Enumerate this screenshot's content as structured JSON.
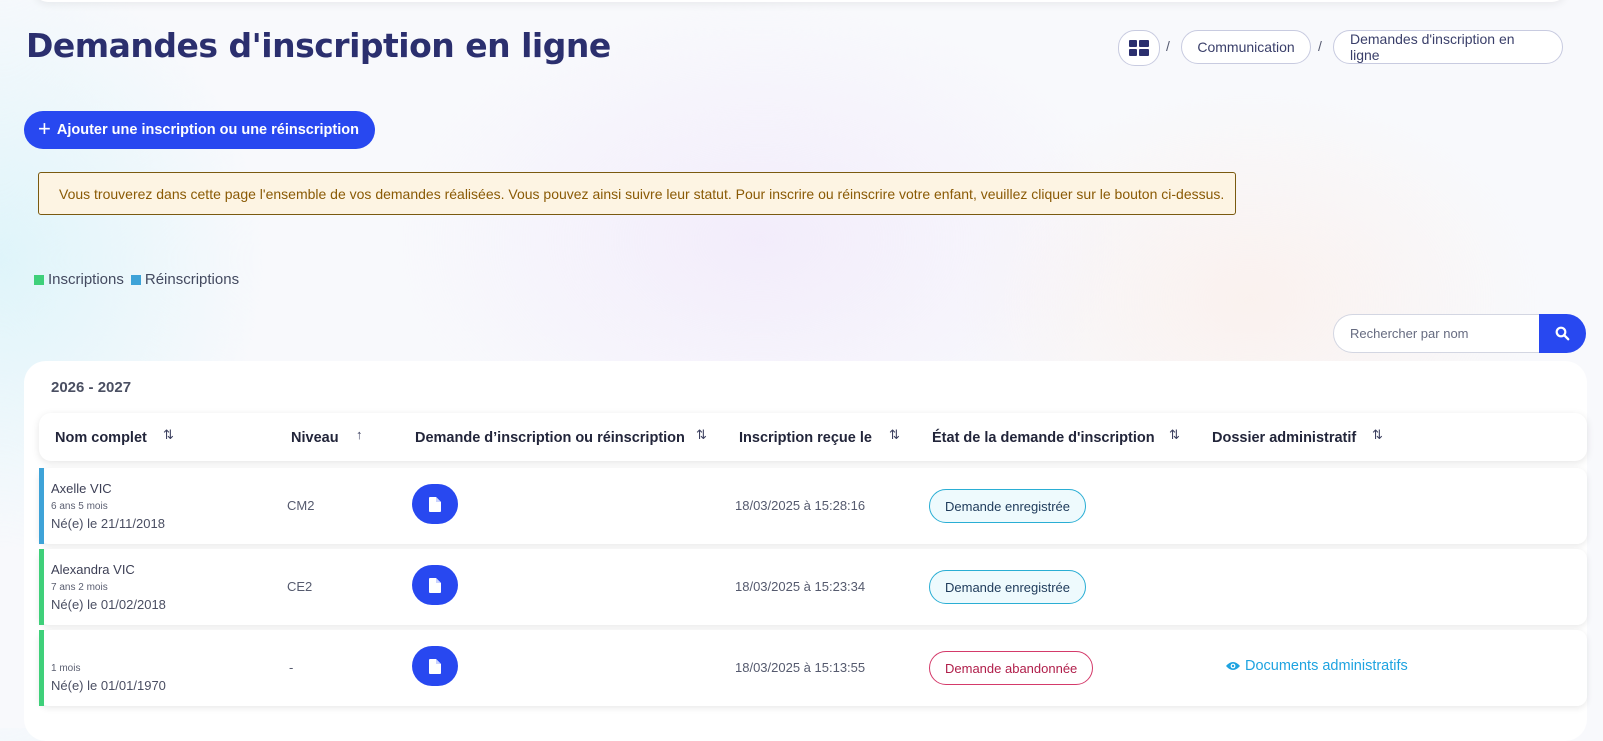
{
  "page": {
    "title": "Demandes d'inscription en ligne"
  },
  "breadcrumb": {
    "separator": "/",
    "items": [
      "Communication",
      "Demandes d'inscription en ligne"
    ]
  },
  "actions": {
    "add_label": "Ajouter une inscription ou une réinscription"
  },
  "info_alert": "Vous trouverez dans cette page l'ensemble de vos demandes réalisées. Vous pouvez ainsi suivre leur statut. Pour inscrire ou réinscrire votre enfant, veuillez cliquer sur le bouton ci-dessus.",
  "legend": [
    {
      "label": "Inscriptions",
      "color": "#3fd07a"
    },
    {
      "label": "Réinscriptions",
      "color": "#3ea3d8"
    }
  ],
  "search": {
    "placeholder": "Rechercher par nom"
  },
  "table": {
    "year": "2026 - 2027",
    "columns": [
      "Nom complet",
      "Niveau",
      "Demande d’inscription ou réinscription",
      "Inscription reçue le",
      "État de la demande d'inscription",
      "Dossier administratif"
    ],
    "rows": [
      {
        "name": "Axelle VIC",
        "age": "6 ans 5 mois",
        "born": "Né(e) le 21/11/2018",
        "level": "CM2",
        "received": "18/03/2025 à 15:28:16",
        "status": "Demande enregistrée",
        "dossier": ""
      },
      {
        "name": "Alexandra VIC",
        "age": "7 ans 2 mois",
        "born": "Né(e) le 01/02/2018",
        "level": "CE2",
        "received": "18/03/2025 à 15:23:34",
        "status": "Demande enregistrée",
        "dossier": ""
      },
      {
        "name": "",
        "age": "1 mois",
        "born": "Né(e) le 01/01/1970",
        "level": "-",
        "received": "18/03/2025 à 15:13:55",
        "status": "Demande abandonnée",
        "dossier": "Documents administratifs"
      }
    ]
  },
  "colors": {
    "primary": "#2848f0",
    "title": "#2b2f6e",
    "status_registered": "#2aaed4",
    "status_abandoned": "#d43a6a",
    "link": "#1ea3e0"
  }
}
